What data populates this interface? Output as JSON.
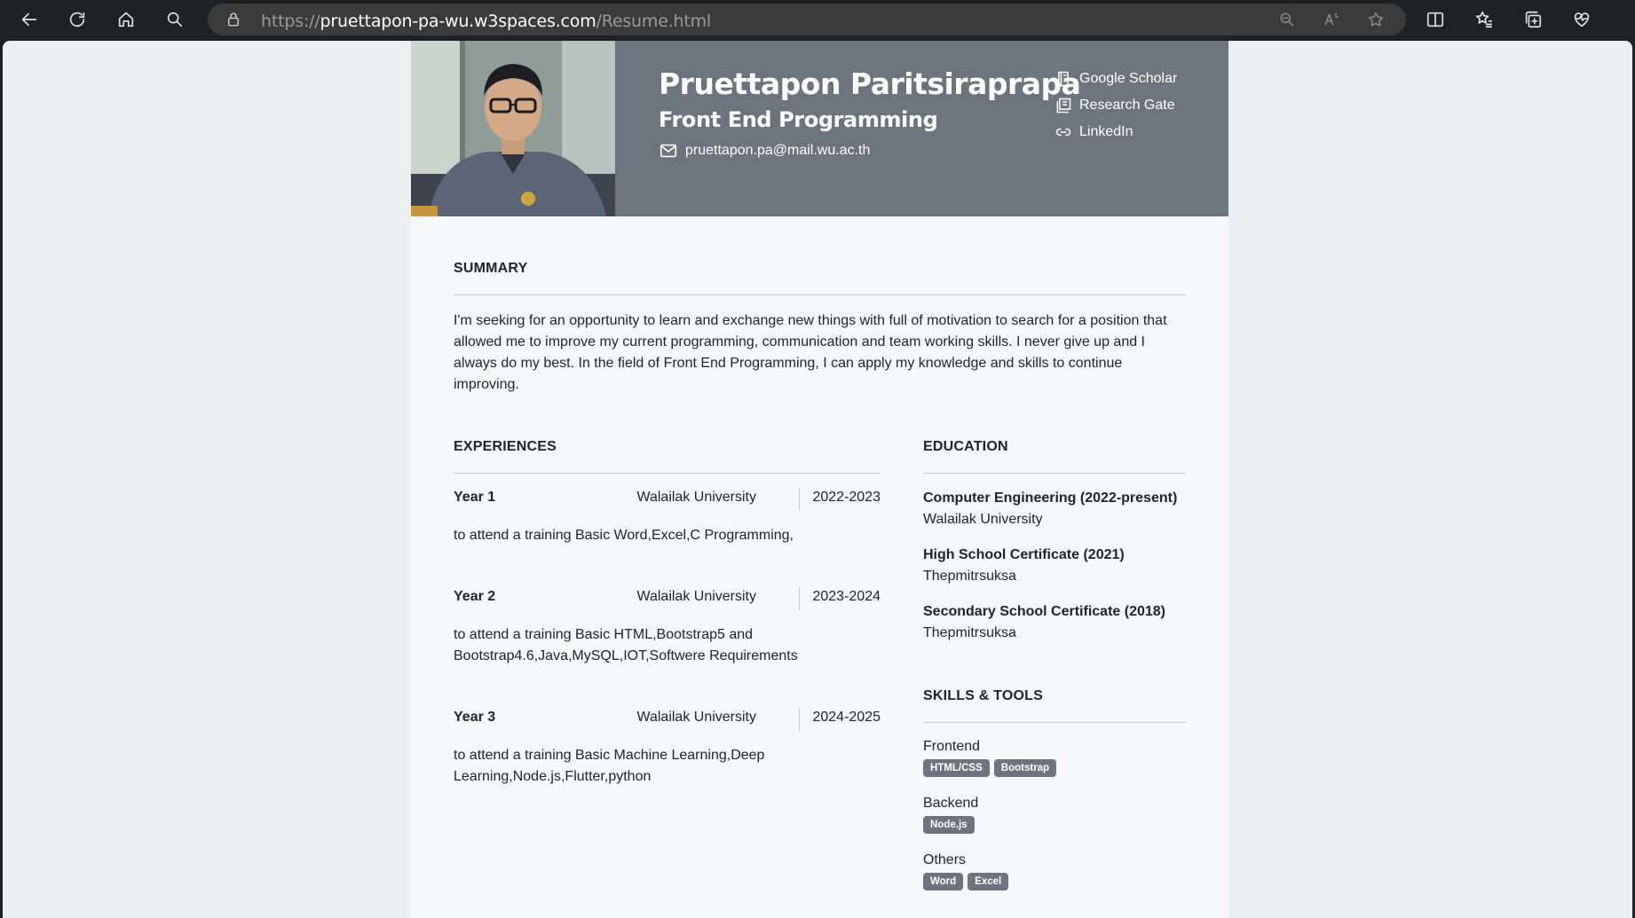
{
  "browser": {
    "url_prefix": "https://",
    "url_host": "pruettapon-pa-wu.w3spaces.com",
    "url_path": "/Resume.html"
  },
  "header": {
    "name": "Pruettapon Paritsiraprapa",
    "role": "Front End Programming",
    "email": "pruettapon.pa@mail.wu.ac.th",
    "links": [
      "Google Scholar",
      "Research Gate",
      "LinkedIn"
    ]
  },
  "summary": {
    "title": "SUMMARY",
    "lines": [
      "I'm seeking for an opportunity to learn and exchange new things with full of motivation to search for a position that",
      "allowed me to improve my current programming, communication and team working skills. I never give up and I",
      "always do my best. In the field of Front End Programming, I can apply my knowledge and skills to continue",
      "improving."
    ]
  },
  "experiences": {
    "title": "EXPERIENCES",
    "items": [
      {
        "year": "Year 1",
        "org": "Walailak University",
        "date": "2022-2023",
        "desc": [
          "to attend a training Basic Word,Excel,C Programming,"
        ]
      },
      {
        "year": "Year 2",
        "org": "Walailak University",
        "date": "2023-2024",
        "desc": [
          "to attend a training Basic HTML,Bootstrap5 and",
          "Bootstrap4.6,Java,MySQL,IOT,Softwere Requirements"
        ]
      },
      {
        "year": "Year 3",
        "org": "Walailak University",
        "date": "2024-2025",
        "desc": [
          "to attend a training Basic Machine Learning,Deep",
          "Learning,Node.js,Flutter,python"
        ]
      }
    ]
  },
  "education": {
    "title": "EDUCATION",
    "items": [
      {
        "degree": "Computer Engineering (2022-present)",
        "school": "Walailak University"
      },
      {
        "degree": "High School Certificate (2021)",
        "school": "Thepmitrsuksa"
      },
      {
        "degree": "Secondary School Certificate (2018)",
        "school": "Thepmitrsuksa"
      }
    ]
  },
  "skills": {
    "title": "SKILLS & TOOLS",
    "groups": [
      {
        "category": "Frontend",
        "tags": [
          "HTML/CSS",
          "Bootstrap"
        ]
      },
      {
        "category": "Backend",
        "tags": [
          "Node.js"
        ]
      },
      {
        "category": "Others",
        "tags": [
          "Word",
          "Excel"
        ]
      }
    ]
  },
  "colors": {
    "header_bg": "#6c757d",
    "badge_bg": "#6c757d",
    "page_bg": "#f7f8fa"
  }
}
